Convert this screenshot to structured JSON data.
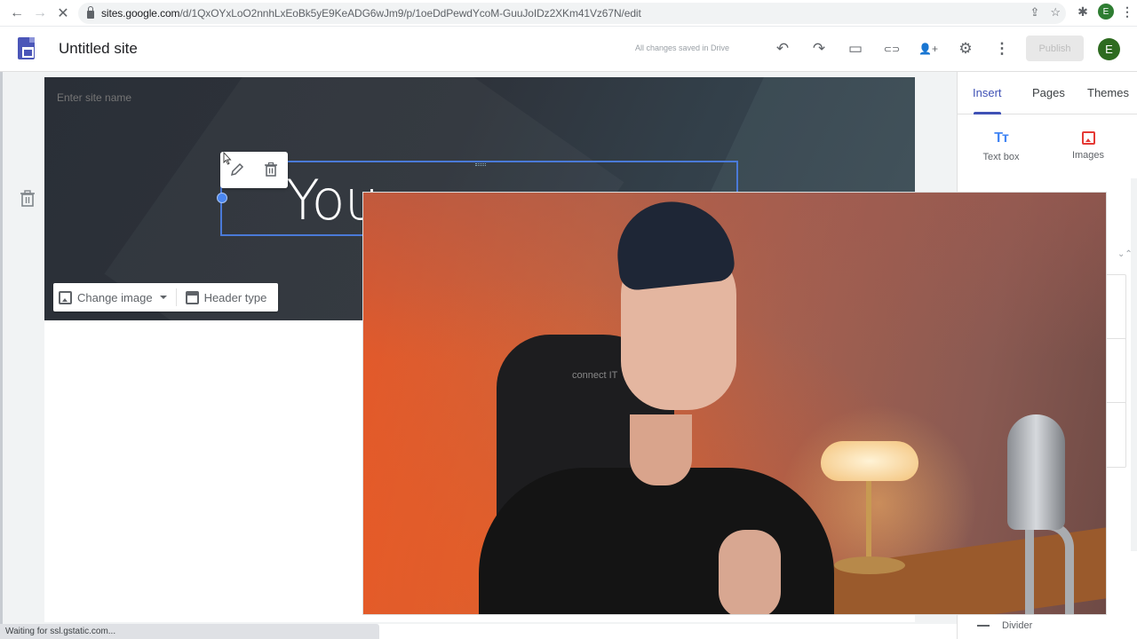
{
  "browser": {
    "url_host": "sites.google.com",
    "url_path": "/d/1QxOYxLoO2nnhLxEoBk5yE9KeADG6wJm9/p/1oeDdPewdYcoM-GuuJoIDz2XKm41Vz67N/edit",
    "profile_initial": "E",
    "nav": {
      "back": "←",
      "forward": "→",
      "stop": "✕"
    },
    "icons": {
      "share": "⇪",
      "bookmark": "☆",
      "extensions": "✱",
      "menu": "⋮"
    }
  },
  "header": {
    "site_title": "Untitled site",
    "save_status": "All changes saved in Drive",
    "icons": {
      "undo": "↶",
      "redo": "↷",
      "preview": "▭",
      "link": "⊂⊃",
      "share": "👤+",
      "settings": "⚙",
      "more": "⋮"
    },
    "publish_label": "Publish",
    "avatar_initial": "E",
    "avatar_color": "#2e6b20",
    "accent_color": "#3f51b5"
  },
  "editor": {
    "site_name_placeholder": "Enter site name",
    "title_text_visible": "You",
    "change_image_label": "Change image",
    "header_type_label": "Header type"
  },
  "panel": {
    "tabs": [
      {
        "label": "Insert",
        "active": true
      },
      {
        "label": "Pages",
        "active": false
      },
      {
        "label": "Themes",
        "active": false
      }
    ],
    "insert_items": [
      {
        "label": "Text box",
        "icon": "Tт"
      },
      {
        "label": "Images",
        "icon": "image"
      }
    ],
    "collapse_icon": "⌄⌃",
    "divider_label": "Divider"
  },
  "webcam": {
    "chair_brand": "connect IT"
  },
  "status_bar": {
    "text": "Waiting for ssl.gstatic.com..."
  }
}
